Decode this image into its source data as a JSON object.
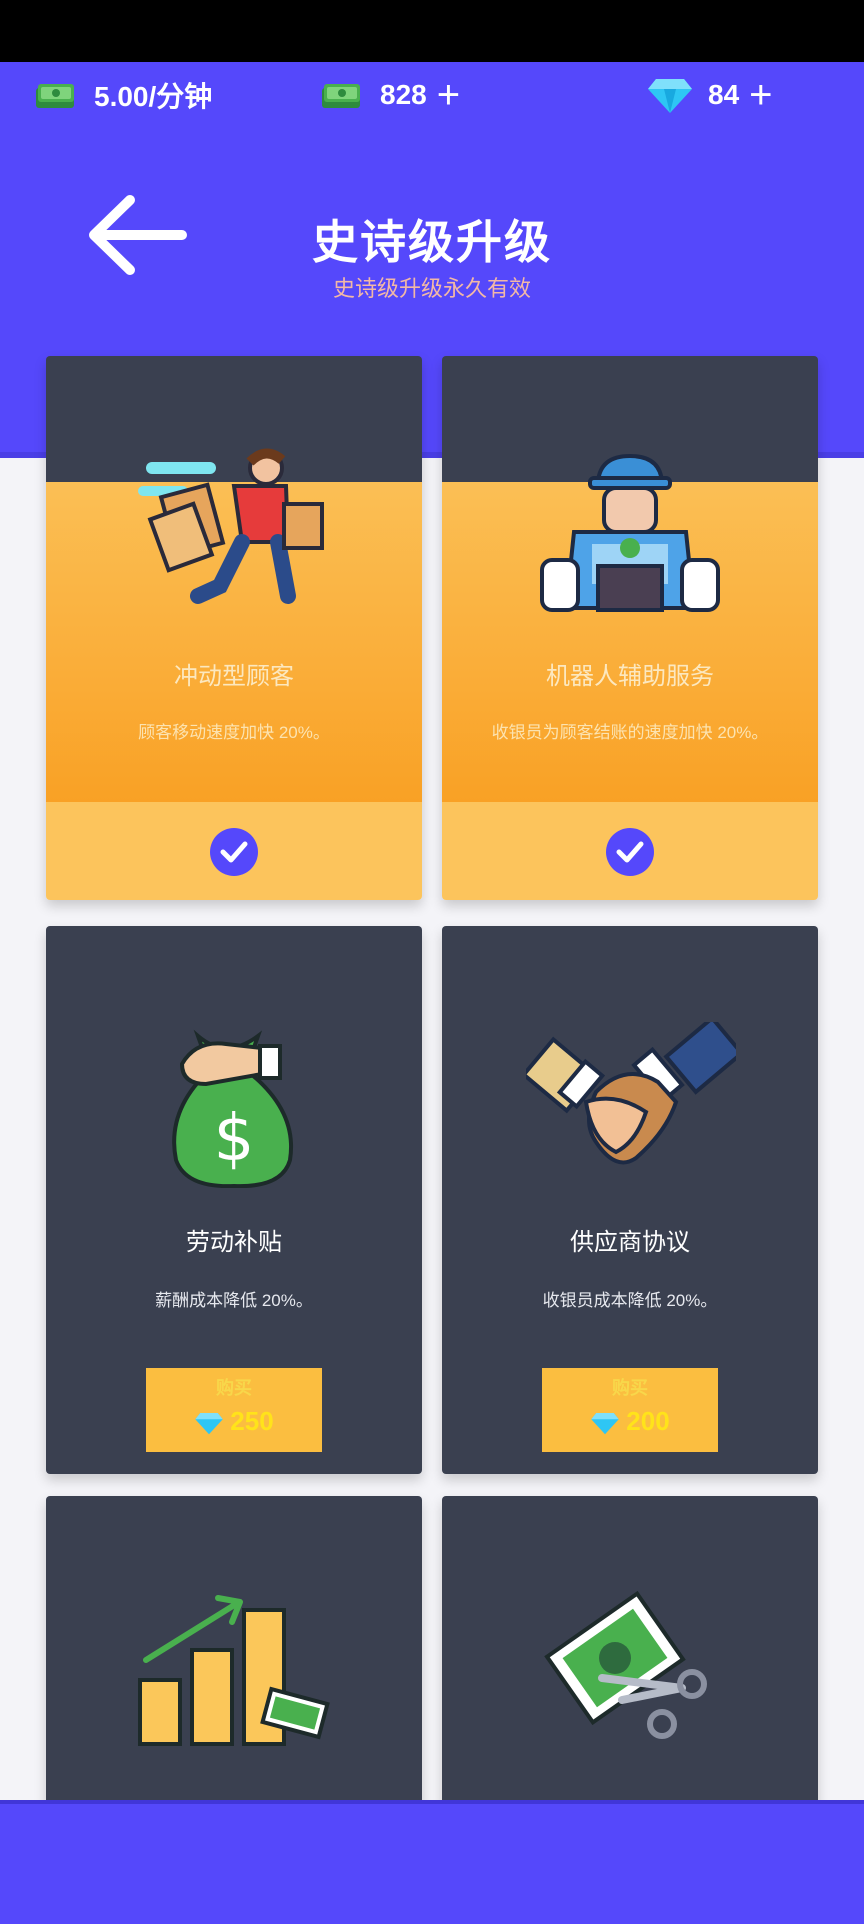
{
  "resources": {
    "income_rate": "5.00/分钟",
    "cash": "828",
    "gems": "84",
    "plus_symbol": "+"
  },
  "header": {
    "title": "史诗级升级",
    "subtitle": "史诗级升级永久有效"
  },
  "cards": [
    {
      "title": "冲动型顾客",
      "description": "顾客移动速度加快 20%。",
      "owned": true,
      "icon": "running-customer-icon"
    },
    {
      "title": "机器人辅助服务",
      "description": "收银员为顾客结账的速度加快 20%。",
      "owned": true,
      "icon": "robot-cashier-icon"
    },
    {
      "title": "劳动补贴",
      "description": "薪酬成本降低 20%。",
      "owned": false,
      "buy_label": "购买",
      "price": "250",
      "icon": "money-bag-icon"
    },
    {
      "title": "供应商协议",
      "description": "收银员成本降低 20%。",
      "owned": false,
      "buy_label": "购买",
      "price": "200",
      "icon": "handshake-icon"
    },
    {
      "title": "",
      "description": "",
      "owned": false,
      "icon": "growth-chart-icon"
    },
    {
      "title": "",
      "description": "",
      "owned": false,
      "icon": "cut-bill-icon"
    }
  ],
  "colors": {
    "primary": "#5548fb",
    "card_dark": "#3a4050",
    "owned_orange": "#f9a125",
    "gold": "#fbbe40",
    "gem": "#2ec6f4"
  }
}
